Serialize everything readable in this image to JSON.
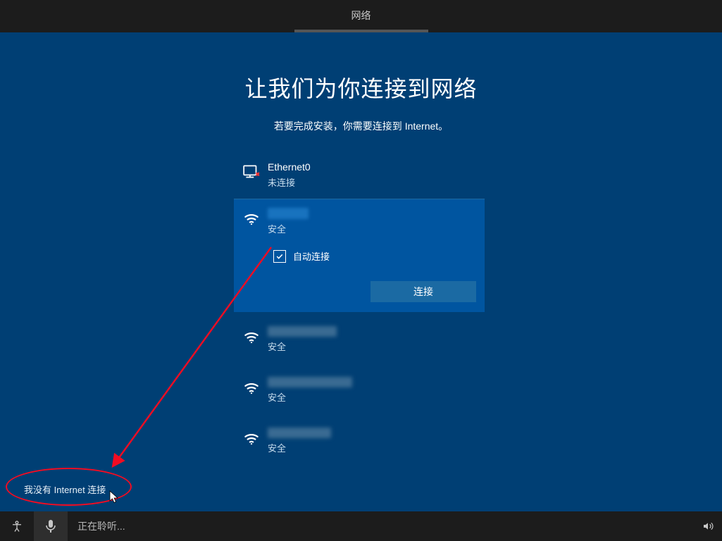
{
  "header": {
    "tab_label": "网络"
  },
  "main": {
    "title": "让我们为你连接到网络",
    "subtitle": "若要完成安装，你需要连接到 Internet。",
    "ethernet": {
      "name": "Ethernet0",
      "status": "未连接"
    },
    "selected_wifi": {
      "status": "安全",
      "auto_connect_label": "自动连接",
      "auto_connect_checked": true,
      "connect_button": "连接"
    },
    "wifi_items": [
      {
        "status": "安全"
      },
      {
        "status": "安全"
      },
      {
        "status": "安全"
      }
    ],
    "skip_link": "我没有 Internet 连接"
  },
  "footer": {
    "listening": "正在聆听..."
  }
}
